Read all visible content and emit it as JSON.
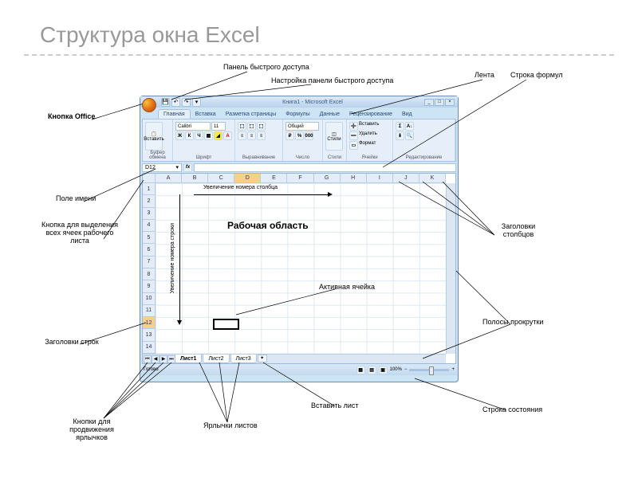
{
  "slide_title": "Структура окна Excel",
  "excel": {
    "app_title": "Книга1 - Microsoft Excel",
    "tabs": [
      "Главная",
      "Вставка",
      "Разметка страницы",
      "Формулы",
      "Данные",
      "Рецензирование",
      "Вид"
    ],
    "ribbon_groups": {
      "clipboard": {
        "label": "Буфер обмена",
        "paste": "Вставить"
      },
      "font": {
        "label": "Шрифт",
        "name": "Calibri",
        "size": "11"
      },
      "align": {
        "label": "Выравнивание"
      },
      "number": {
        "label": "Число",
        "format": "Общий"
      },
      "styles": {
        "label": "Стили",
        "btn": "Стили"
      },
      "cells": {
        "label": "Ячейки",
        "ins": "Вставить",
        "del": "Удалить",
        "fmt": "Формат"
      },
      "edit": {
        "label": "Редактирование"
      }
    },
    "namebox": "D12",
    "columns": [
      "A",
      "B",
      "C",
      "D",
      "E",
      "F",
      "G",
      "H",
      "I",
      "J",
      "K"
    ],
    "rows": [
      "1",
      "2",
      "3",
      "4",
      "5",
      "6",
      "7",
      "8",
      "9",
      "10",
      "11",
      "12",
      "13",
      "14"
    ],
    "sheets": [
      "Лист1",
      "Лист2",
      "Лист3"
    ],
    "status_ready": "Готово",
    "zoom": "100%",
    "work_area": "Рабочая область",
    "col_inc": "Увеличение номера столбца",
    "row_inc": "Увеличение номера строки"
  },
  "callouts": {
    "qat": "Панель быстрого доступа",
    "qat_cfg": "Настройка панели быстрого доступа",
    "ribbon": "Лента",
    "fbar": "Строка формул",
    "office": "Кнопка Office",
    "namebox": "Поле имени",
    "selectall": "Кнопка для выделения всех ячеек рабочего листа",
    "rowhdrs": "Заголовки строк",
    "navbtns": "Кнопки для продвижения ярлычков",
    "sheettabs": "Ярлычки листов",
    "insertsheet": "Вставить лист",
    "statusbar": "Строка состояния",
    "scrollbars": "Полосы прокрутки",
    "colhdrs": "Заголовки столбцов",
    "activecell": "Активная ячейка"
  }
}
